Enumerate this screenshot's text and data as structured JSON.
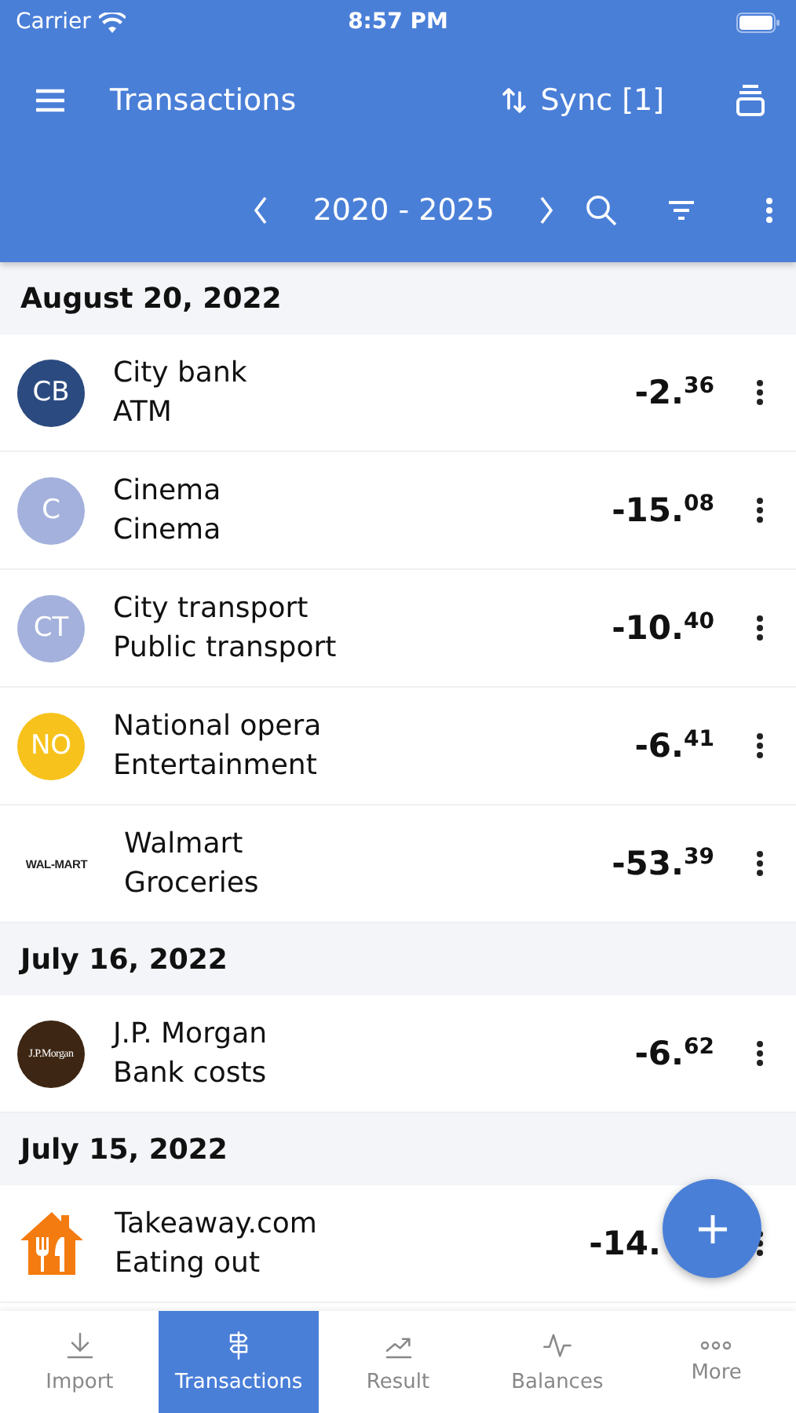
{
  "status_bar": {
    "carrier": "Carrier",
    "time": "8:57 PM"
  },
  "toolbar": {
    "title": "Transactions",
    "sync": "Sync [1]",
    "period": "2020 - 2025"
  },
  "sections": [
    {
      "date": "August 20, 2022",
      "transactions": [
        {
          "avatar": {
            "kind": "initials",
            "text": "CB",
            "color": "#2b4a80"
          },
          "name": "City bank",
          "category": "ATM",
          "amount": {
            "whole": "-2.",
            "cents": "36"
          }
        },
        {
          "avatar": {
            "kind": "initials",
            "text": "C",
            "color": "#a3b1dc"
          },
          "name": "Cinema",
          "category": "Cinema",
          "amount": {
            "whole": "-15.",
            "cents": "08"
          }
        },
        {
          "avatar": {
            "kind": "initials",
            "text": "CT",
            "color": "#a3b1dc"
          },
          "name": "City transport",
          "category": "Public transport",
          "amount": {
            "whole": "-10.",
            "cents": "40"
          }
        },
        {
          "avatar": {
            "kind": "initials",
            "text": "NO",
            "color": "#f7c21b"
          },
          "name": "National opera",
          "category": "Entertainment",
          "amount": {
            "whole": "-6.",
            "cents": "41"
          }
        },
        {
          "avatar": {
            "kind": "wordmark",
            "text": "WAL-MART",
            "color": "#ffffff"
          },
          "name": "Walmart",
          "category": "Groceries",
          "amount": {
            "whole": "-53.",
            "cents": "39"
          }
        }
      ]
    },
    {
      "date": "July 16, 2022",
      "transactions": [
        {
          "avatar": {
            "kind": "initials_serif",
            "text": "J.P.Morgan",
            "color": "#3d2613"
          },
          "name": "J.P. Morgan",
          "category": "Bank costs",
          "amount": {
            "whole": "-6.",
            "cents": "62"
          }
        }
      ]
    },
    {
      "date": "July 15, 2022",
      "transactions": [
        {
          "avatar": {
            "kind": "house",
            "color": "#f47b10"
          },
          "name": "Takeaway.com",
          "category": "Eating out",
          "amount": {
            "whole": "-14."
          }
        }
      ]
    }
  ],
  "tabs": [
    {
      "label": "Import",
      "kind": "import",
      "selected": false
    },
    {
      "label": "Transactions",
      "kind": "signpost",
      "selected": true
    },
    {
      "label": "Result",
      "kind": "trend",
      "selected": false
    },
    {
      "label": "Balances",
      "kind": "pulse",
      "selected": false
    },
    {
      "label": "More",
      "kind": "more",
      "selected": false
    }
  ]
}
